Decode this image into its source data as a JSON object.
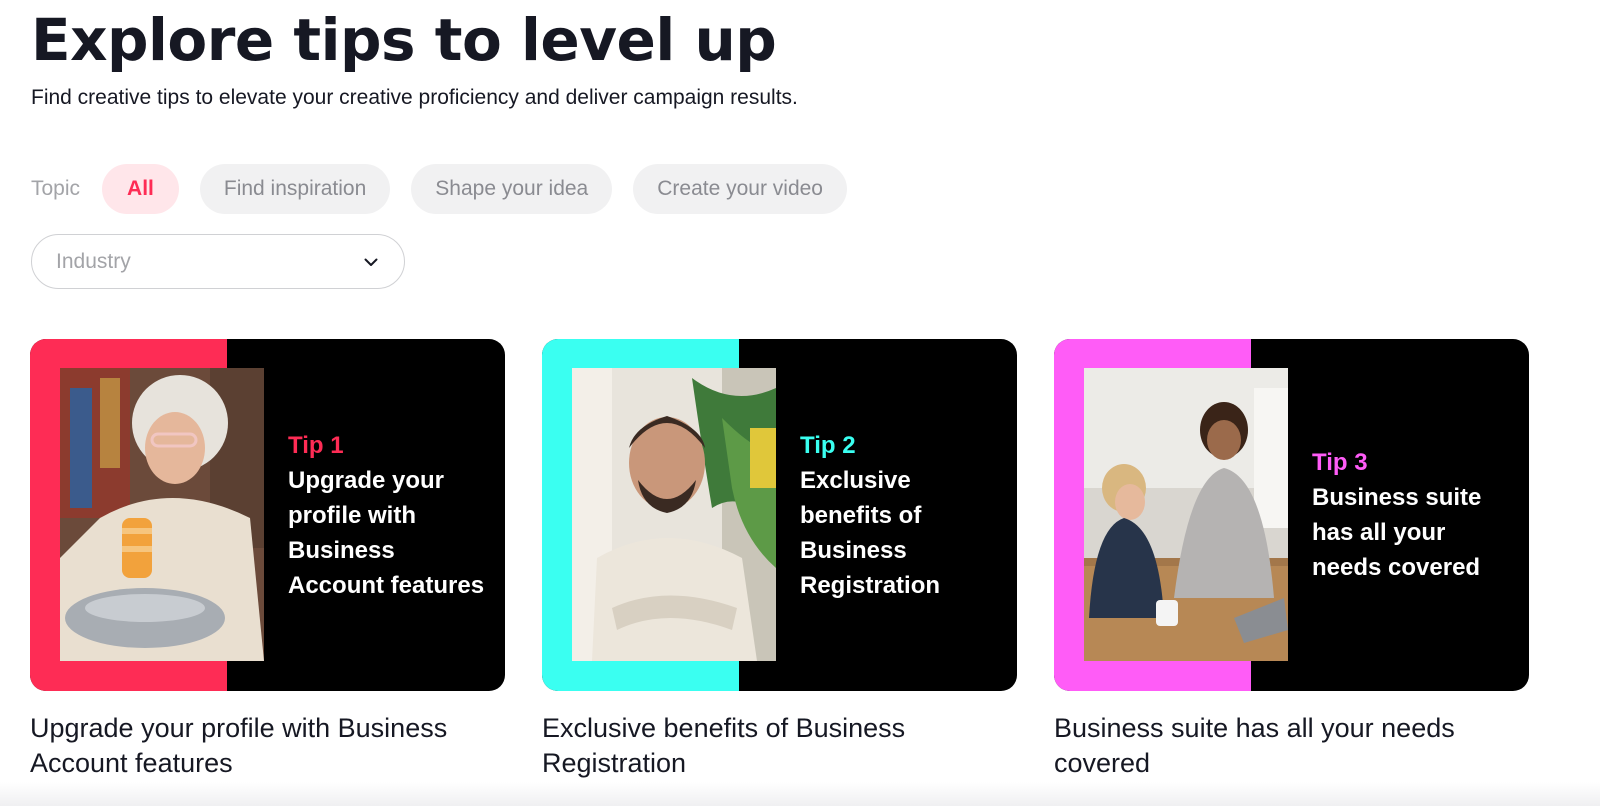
{
  "header": {
    "title": "Explore tips to level up",
    "subtitle": "Find creative tips to elevate your creative proficiency and deliver campaign results."
  },
  "filters": {
    "topic_label": "Topic",
    "chips": [
      {
        "label": "All",
        "selected": true
      },
      {
        "label": "Find inspiration",
        "selected": false
      },
      {
        "label": "Shape your idea",
        "selected": false
      },
      {
        "label": "Create your video",
        "selected": false
      }
    ],
    "industry": {
      "placeholder": "Industry",
      "icon": "chevron-down-icon"
    }
  },
  "colors": {
    "brand_red": "#fe2c55",
    "brand_cyan": "#3afff1",
    "brand_magenta": "#ff5cf7",
    "chip_active_bg": "#ffe6ea"
  },
  "cards": [
    {
      "tip_label": "Tip 1",
      "banner_headline": "Upgrade your profile with Business Account features",
      "caption": "Upgrade your profile with Business Account features",
      "accent": "#fe2c55",
      "photo": "woman-with-glass-vase-photo"
    },
    {
      "tip_label": "Tip 2",
      "banner_headline": "Exclusive benefits of Business Registration",
      "caption": "Exclusive benefits of Business Registration",
      "accent": "#3afff1",
      "photo": "smiling-man-arms-crossed-photo"
    },
    {
      "tip_label": "Tip 3",
      "banner_headline": "Business suite has all your needs covered",
      "caption": "Business suite has all your needs covered",
      "accent": "#ff5cf7",
      "photo": "two-women-with-laptop-photo"
    }
  ]
}
